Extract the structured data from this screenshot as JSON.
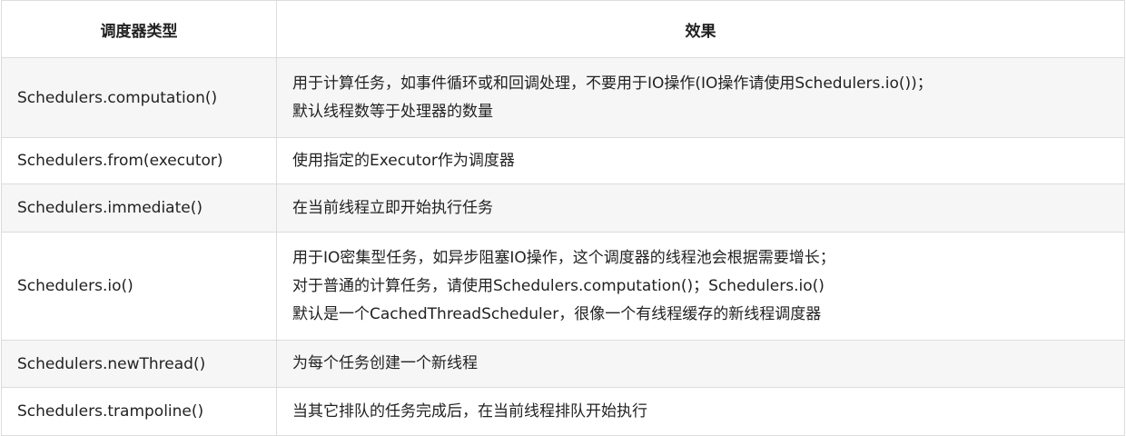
{
  "table": {
    "headers": {
      "type": "调度器类型",
      "effect": "效果"
    },
    "rows": [
      {
        "name": "Schedulers.computation()",
        "effect": [
          "用于计算任务，如事件循环或和回调处理，不要用于IO操作(IO操作请使用Schedulers.io())；",
          "默认线程数等于处理器的数量"
        ]
      },
      {
        "name": "Schedulers.from(executor)",
        "effect": [
          "使用指定的Executor作为调度器"
        ]
      },
      {
        "name": "Schedulers.immediate()",
        "effect": [
          "在当前线程立即开始执行任务"
        ]
      },
      {
        "name": "Schedulers.io()",
        "effect": [
          "用于IO密集型任务，如异步阻塞IO操作，这个调度器的线程池会根据需要增长；",
          "对于普通的计算任务，请使用Schedulers.computation()；Schedulers.io()",
          "默认是一个CachedThreadScheduler，很像一个有线程缓存的新线程调度器"
        ]
      },
      {
        "name": "Schedulers.newThread()",
        "effect": [
          "为每个任务创建一个新线程"
        ]
      },
      {
        "name": "Schedulers.trampoline()",
        "effect": [
          "当其它排队的任务完成后，在当前线程排队开始执行"
        ]
      }
    ]
  }
}
